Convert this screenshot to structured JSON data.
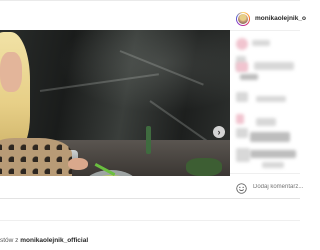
{
  "post": {
    "username": "monikaolejnik_o",
    "media": {
      "icons": {
        "next": "chevron-right-icon",
        "sound": "speaker-icon"
      }
    },
    "comment_box": {
      "placeholder": "Dodaj komentarz...",
      "emoji_icon": "smiley-icon"
    }
  },
  "footer": {
    "prefix": "stów z ",
    "account": "monikaolejnik_official"
  },
  "colors": {
    "text": "#262626",
    "muted": "#9a9a9a",
    "story_ring": "#d62976"
  }
}
